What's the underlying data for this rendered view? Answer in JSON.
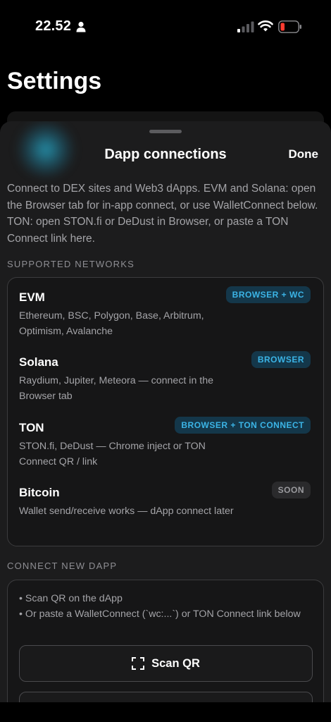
{
  "status_bar": {
    "time": "22.52"
  },
  "background": {
    "title": "Settings"
  },
  "sheet": {
    "title": "Dapp connections",
    "done_label": "Done",
    "intro": "Connect to DEX sites and Web3 dApps. EVM and Solana: open the Browser tab for in-app connect, or use WalletConnect below. TON: open STON.fi or DeDust in Browser, or paste a TON Connect link here."
  },
  "supported_networks": {
    "header": "SUPPORTED NETWORKS",
    "items": [
      {
        "name": "EVM",
        "description": "Ethereum, BSC, Polygon, Base, Arbitrum, Optimism, Avalanche",
        "badge": "BROWSER + WC",
        "badge_style": "blue"
      },
      {
        "name": "Solana",
        "description": "Raydium, Jupiter, Meteora — connect in the Browser tab",
        "badge": "BROWSER",
        "badge_style": "blue"
      },
      {
        "name": "TON",
        "description": "STON.fi, DeDust — Chrome inject or TON Connect QR / link",
        "badge": "BROWSER + TON CONNECT",
        "badge_style": "blue"
      },
      {
        "name": "Bitcoin",
        "description": "Wallet send/receive works — dApp connect later",
        "badge": "SOON",
        "badge_style": "gray"
      }
    ]
  },
  "connect_new": {
    "header": "CONNECT NEW DAPP",
    "bullet_1": "• Scan QR on the dApp",
    "bullet_2": "• Or paste a WalletConnect (`wc:...`) or TON Connect link below",
    "scan_label": "Scan QR",
    "scan_icon": "qr-scan-icon"
  },
  "colors": {
    "accent": "#3bb4e6",
    "badge_blue_bg": "#14374a",
    "sheet_bg": "#1c1c1d",
    "battery_low": "#ff3b30"
  }
}
